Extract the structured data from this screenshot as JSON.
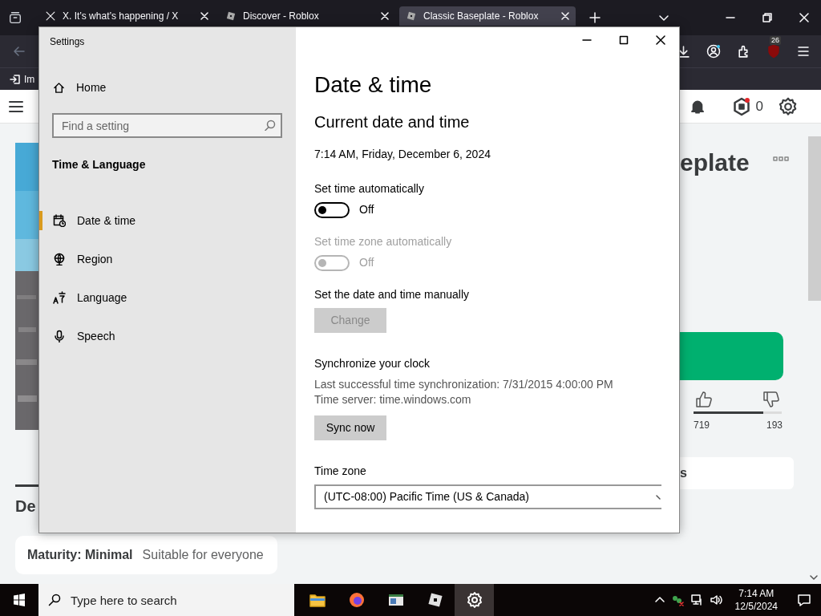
{
  "browser": {
    "tabs": [
      {
        "title": "X. It’s what’s happening / X",
        "selected": false
      },
      {
        "title": "Discover - Roblox",
        "selected": false
      },
      {
        "title": "Classic Baseplate - Roblox",
        "selected": true
      }
    ],
    "extension_badge": "26",
    "bookmark": "Im",
    "robux": "0",
    "game_title": "eplate",
    "likes": "719",
    "dislikes": "193",
    "tab_label": "s",
    "section_heading": "De",
    "maturity_label": "Maturity: Minimal",
    "maturity_text": "Suitable for everyone"
  },
  "settings": {
    "title": "Settings",
    "home": "Home",
    "search": {
      "placeholder": "Find a setting"
    },
    "category": "Time & Language",
    "nav": [
      {
        "label": "Date & time",
        "selected": true
      },
      {
        "label": "Region",
        "selected": false
      },
      {
        "label": "Language",
        "selected": false
      },
      {
        "label": "Speech",
        "selected": false
      }
    ],
    "heading": "Date & time",
    "subheading": "Current date and time",
    "current": "7:14 AM, Friday, December 6, 2024",
    "items": [
      {
        "kind": "toggle",
        "label": "Set time automatically",
        "on": false,
        "disabled": false,
        "state": "Off"
      },
      {
        "kind": "toggle",
        "label": "Set time zone automatically",
        "on": false,
        "disabled": true,
        "state": "Off"
      },
      {
        "kind": "button",
        "label": "Set the date and time manually",
        "button": "Change",
        "disabled": true
      }
    ],
    "sync": {
      "heading": "Synchronize your clock",
      "lines": [
        "Last successful time synchronization: 7/31/2015 4:00:00 PM",
        "Time server: time.windows.com"
      ],
      "button": "Sync now"
    },
    "time_zone": {
      "label": "Time zone",
      "value": "(UTC-08:00) Pacific Time (US & Canada)"
    }
  },
  "taskbar": {
    "search": {
      "placeholder": "Type here to search"
    },
    "apps": [
      {
        "kind": "folder",
        "selected": false
      },
      {
        "kind": "firefox",
        "selected": false
      },
      {
        "kind": "window",
        "selected": false
      },
      {
        "kind": "roblox",
        "selected": false
      },
      {
        "kind": "gear",
        "selected": true
      }
    ],
    "time": "7:14 AM",
    "date": "12/5/2024"
  }
}
